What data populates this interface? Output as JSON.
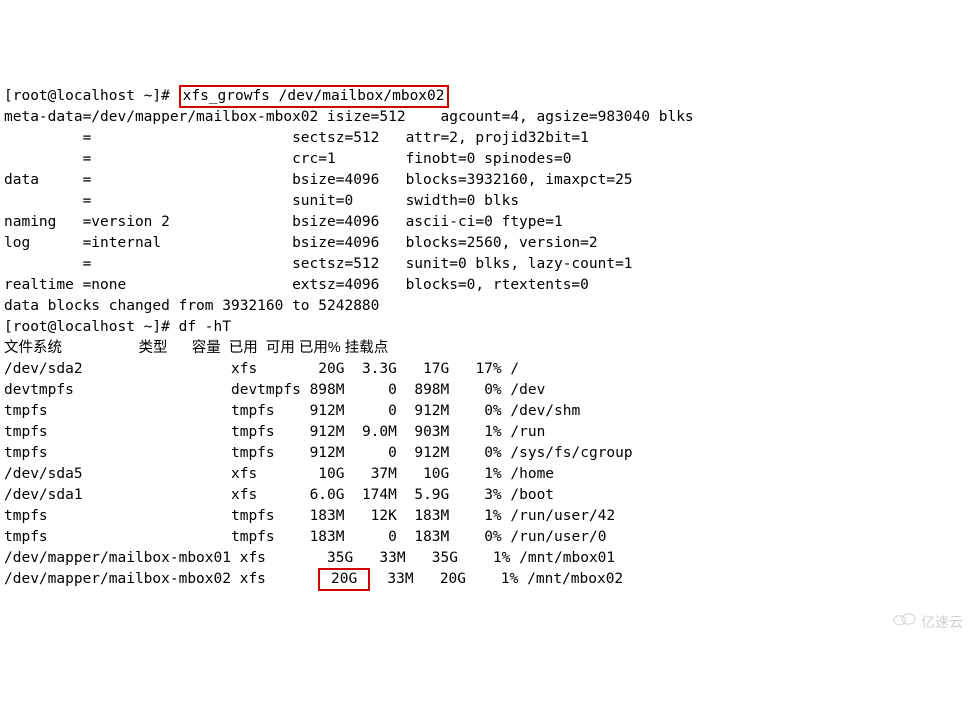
{
  "prompt": "[root@localhost ~]# ",
  "cmd1": "xfs_growfs /dev/mailbox/mbox02",
  "growfs_output": [
    "meta-data=/dev/mapper/mailbox-mbox02 isize=512    agcount=4, agsize=983040 blks",
    "         =                       sectsz=512   attr=2, projid32bit=1",
    "         =                       crc=1        finobt=0 spinodes=0",
    "data     =                       bsize=4096   blocks=3932160, imaxpct=25",
    "         =                       sunit=0      swidth=0 blks",
    "naming   =version 2              bsize=4096   ascii-ci=0 ftype=1",
    "log      =internal               bsize=4096   blocks=2560, version=2",
    "         =                       sectsz=512   sunit=0 blks, lazy-count=1",
    "realtime =none                   extsz=4096   blocks=0, rtextents=0",
    "data blocks changed from 3932160 to 5242880"
  ],
  "cmd2": "df -hT",
  "df_header": "文件系统                   类型      容量  已用  可用 已用% 挂载点",
  "df_rows": [
    {
      "fs": "/dev/sda2                 ",
      "type": "xfs       ",
      "size": "20G  ",
      "used": "3.3G   ",
      "avail": "17G   ",
      "pct": "17% ",
      "mount": "/"
    },
    {
      "fs": "devtmpfs                  ",
      "type": "devtmpfs ",
      "size": "898M     ",
      "used": "0  ",
      "avail": "898M    ",
      "pct": "0% ",
      "mount": "/dev"
    },
    {
      "fs": "tmpfs                     ",
      "type": "tmpfs    ",
      "size": "912M     ",
      "used": "0  ",
      "avail": "912M    ",
      "pct": "0% ",
      "mount": "/dev/shm"
    },
    {
      "fs": "tmpfs                     ",
      "type": "tmpfs    ",
      "size": "912M  ",
      "used": "9.0M  ",
      "avail": "903M    ",
      "pct": "1% ",
      "mount": "/run"
    },
    {
      "fs": "tmpfs                     ",
      "type": "tmpfs    ",
      "size": "912M     ",
      "used": "0  ",
      "avail": "912M    ",
      "pct": "0% ",
      "mount": "/sys/fs/cgroup"
    },
    {
      "fs": "/dev/sda5                 ",
      "type": "xfs       ",
      "size": "10G   ",
      "used": "37M   ",
      "avail": "10G    ",
      "pct": "1% ",
      "mount": "/home"
    },
    {
      "fs": "/dev/sda1                 ",
      "type": "xfs      ",
      "size": "6.0G  ",
      "used": "174M  ",
      "avail": "5.9G    ",
      "pct": "3% ",
      "mount": "/boot"
    },
    {
      "fs": "tmpfs                     ",
      "type": "tmpfs    ",
      "size": "183M   ",
      "used": "12K  ",
      "avail": "183M    ",
      "pct": "1% ",
      "mount": "/run/user/42"
    },
    {
      "fs": "tmpfs                     ",
      "type": "tmpfs    ",
      "size": "183M     ",
      "used": "0  ",
      "avail": "183M    ",
      "pct": "0% ",
      "mount": "/run/user/0"
    },
    {
      "fs": "/dev/mapper/mailbox-mbox01",
      "type": " xfs       ",
      "size": "35G   ",
      "used": "33M   ",
      "avail": "35G    ",
      "pct": "1% ",
      "mount": "/mnt/mbox01"
    }
  ],
  "df_last": {
    "fs": "/dev/mapper/mailbox-mbox02",
    "type": " xfs      ",
    "size": " 20G ",
    "gap": "  ",
    "used": "33M   ",
    "avail": "20G    ",
    "pct": "1% ",
    "mount": "/mnt/mbox02"
  },
  "watermark": "亿速云"
}
